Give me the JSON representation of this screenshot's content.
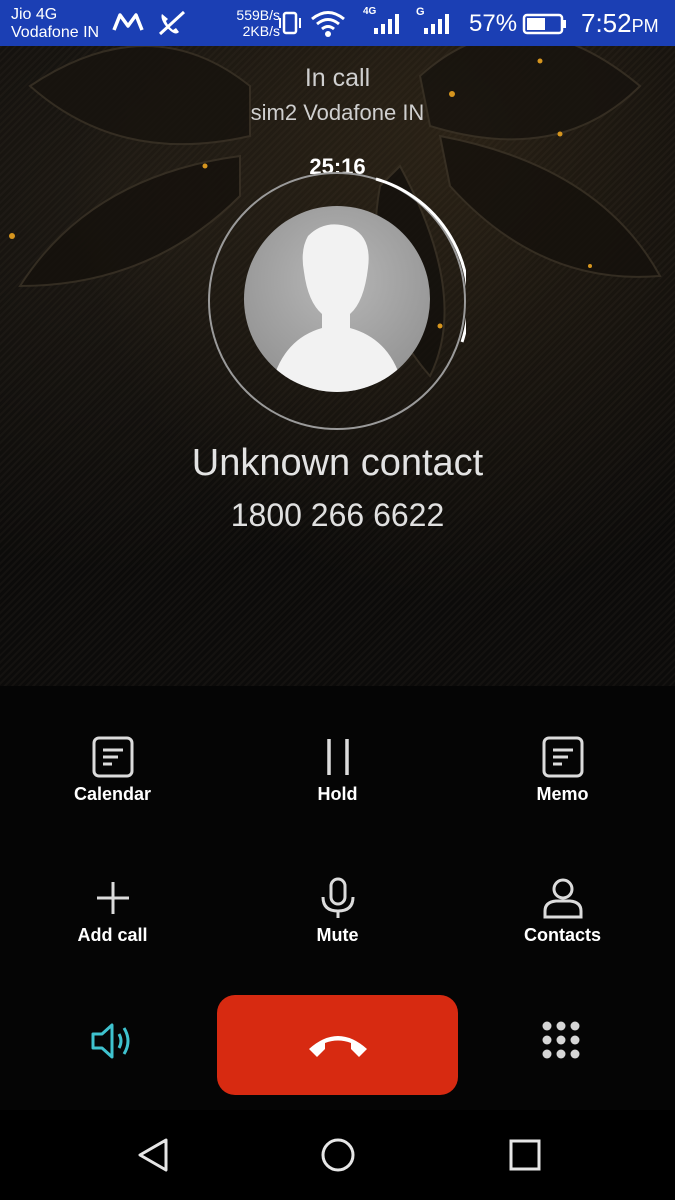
{
  "status_bar": {
    "carrier_line1": "Jio 4G",
    "carrier_line2": "Vodafone IN",
    "speed_up": "559B/s",
    "speed_down": "2KB/s",
    "network_4g": "4G",
    "network_g": "G",
    "battery_percent": "57%",
    "time": "7:52",
    "ampm": "PM"
  },
  "call": {
    "state": "In call",
    "sim": "sim2 Vodafone IN",
    "timer": "25:16",
    "contact_name": "Unknown contact",
    "number": "1800 266 6622"
  },
  "controls": {
    "calendar": "Calendar",
    "hold": "Hold",
    "memo": "Memo",
    "add_call": "Add call",
    "mute": "Mute",
    "contacts": "Contacts"
  },
  "colors": {
    "status_bar": "#1b3fb4",
    "end_call": "#d72a11",
    "speaker_accent": "#3fc3cf"
  }
}
